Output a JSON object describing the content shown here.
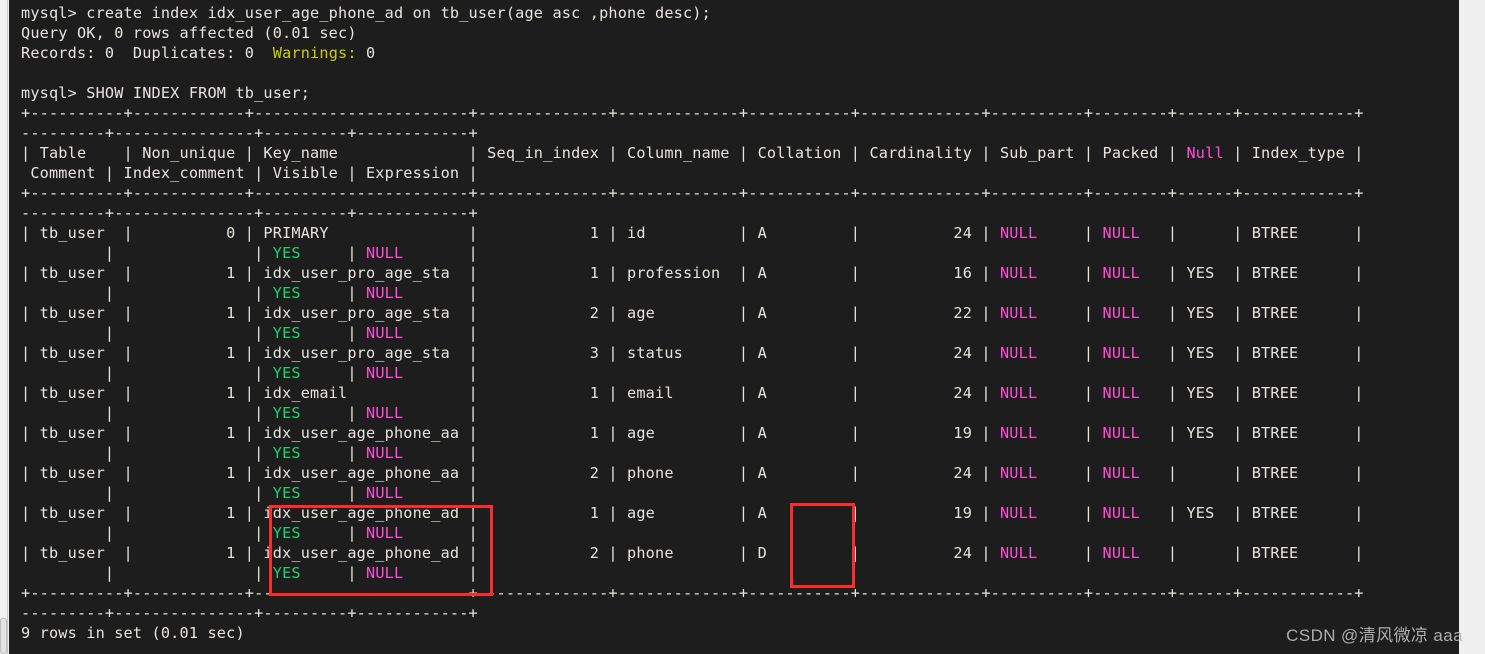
{
  "terminal": {
    "prompt": "mysql>",
    "commands": [
      "create index idx_user_age_phone_ad on tb_user(age asc ,phone desc);",
      "SHOW INDEX FROM tb_user;"
    ],
    "query_ok_line": "Query OK, 0 rows affected (0.01 sec)",
    "records_label": "Records: 0  Duplicates: 0  ",
    "warnings_label": "Warnings:",
    "warnings_value": " 0",
    "footer": "9 rows in set (0.01 sec)",
    "colors": {
      "background": "#1d1d1d",
      "foreground": "#e8e4dc",
      "warning": "#cdcd00",
      "null": "#ff4fd8",
      "yes": "#1ed173",
      "annotation": "#fa2c2c"
    }
  },
  "result_table": {
    "border_top": "+----------+------------+----------------------+--------------+-------------+-------------+-------------+----------+--------+------+------------+---------+---------------+---------+------------+",
    "columns": [
      "Table",
      "Non_unique",
      "Key_name",
      "Seq_in_index",
      "Column_name",
      "Collation",
      "Cardinality",
      "Sub_part",
      "Packed",
      "Null",
      "Index_type",
      "Comment",
      "Index_comment",
      "Visible",
      "Expression"
    ],
    "rows": [
      {
        "Table": "tb_user",
        "Non_unique": "0",
        "Key_name": "PRIMARY",
        "Seq_in_index": "1",
        "Column_name": "id",
        "Collation": "A",
        "Cardinality": "24",
        "Sub_part": "NULL",
        "Packed": "NULL",
        "Null": "",
        "Index_type": "BTREE",
        "Comment": "",
        "Index_comment": "",
        "Visible": "YES",
        "Expression": "NULL"
      },
      {
        "Table": "tb_user",
        "Non_unique": "1",
        "Key_name": "idx_user_pro_age_sta",
        "Seq_in_index": "1",
        "Column_name": "profession",
        "Collation": "A",
        "Cardinality": "16",
        "Sub_part": "NULL",
        "Packed": "NULL",
        "Null": "YES",
        "Index_type": "BTREE",
        "Comment": "",
        "Index_comment": "",
        "Visible": "YES",
        "Expression": "NULL"
      },
      {
        "Table": "tb_user",
        "Non_unique": "1",
        "Key_name": "idx_user_pro_age_sta",
        "Seq_in_index": "2",
        "Column_name": "age",
        "Collation": "A",
        "Cardinality": "22",
        "Sub_part": "NULL",
        "Packed": "NULL",
        "Null": "YES",
        "Index_type": "BTREE",
        "Comment": "",
        "Index_comment": "",
        "Visible": "YES",
        "Expression": "NULL"
      },
      {
        "Table": "tb_user",
        "Non_unique": "1",
        "Key_name": "idx_user_pro_age_sta",
        "Seq_in_index": "3",
        "Column_name": "status",
        "Collation": "A",
        "Cardinality": "24",
        "Sub_part": "NULL",
        "Packed": "NULL",
        "Null": "YES",
        "Index_type": "BTREE",
        "Comment": "",
        "Index_comment": "",
        "Visible": "YES",
        "Expression": "NULL"
      },
      {
        "Table": "tb_user",
        "Non_unique": "1",
        "Key_name": "idx_email",
        "Seq_in_index": "1",
        "Column_name": "email",
        "Collation": "A",
        "Cardinality": "24",
        "Sub_part": "NULL",
        "Packed": "NULL",
        "Null": "YES",
        "Index_type": "BTREE",
        "Comment": "",
        "Index_comment": "",
        "Visible": "YES",
        "Expression": "NULL"
      },
      {
        "Table": "tb_user",
        "Non_unique": "1",
        "Key_name": "idx_user_age_phone_aa",
        "Seq_in_index": "1",
        "Column_name": "age",
        "Collation": "A",
        "Cardinality": "19",
        "Sub_part": "NULL",
        "Packed": "NULL",
        "Null": "YES",
        "Index_type": "BTREE",
        "Comment": "",
        "Index_comment": "",
        "Visible": "YES",
        "Expression": "NULL"
      },
      {
        "Table": "tb_user",
        "Non_unique": "1",
        "Key_name": "idx_user_age_phone_aa",
        "Seq_in_index": "2",
        "Column_name": "phone",
        "Collation": "A",
        "Cardinality": "24",
        "Sub_part": "NULL",
        "Packed": "NULL",
        "Null": "",
        "Index_type": "BTREE",
        "Comment": "",
        "Index_comment": "",
        "Visible": "YES",
        "Expression": "NULL"
      },
      {
        "Table": "tb_user",
        "Non_unique": "1",
        "Key_name": "idx_user_age_phone_ad",
        "Seq_in_index": "1",
        "Column_name": "age",
        "Collation": "A",
        "Cardinality": "19",
        "Sub_part": "NULL",
        "Packed": "NULL",
        "Null": "YES",
        "Index_type": "BTREE",
        "Comment": "",
        "Index_comment": "",
        "Visible": "YES",
        "Expression": "NULL"
      },
      {
        "Table": "tb_user",
        "Non_unique": "1",
        "Key_name": "idx_user_age_phone_ad",
        "Seq_in_index": "2",
        "Column_name": "phone",
        "Collation": "D",
        "Cardinality": "24",
        "Sub_part": "NULL",
        "Packed": "NULL",
        "Null": "",
        "Index_type": "BTREE",
        "Comment": "",
        "Index_comment": "",
        "Visible": "YES",
        "Expression": "NULL"
      }
    ],
    "row_count": 9
  },
  "annotations": [
    {
      "name": "key-name-highlight",
      "target": "idx_user_age_phone_ad key_name cells"
    },
    {
      "name": "collation-highlight",
      "target": "A / D collation cells"
    }
  ],
  "watermark": "CSDN @清风微凉 aaa",
  "scrollbars": {
    "vertical_thumb_color": "#f59a23",
    "outer_thumb_color": "#8d8d8d"
  }
}
